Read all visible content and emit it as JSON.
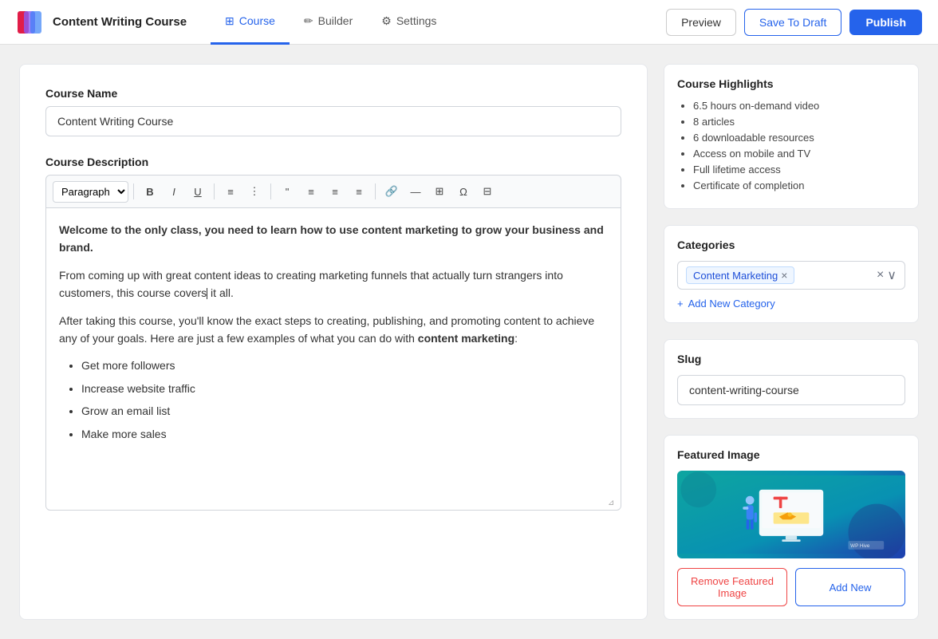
{
  "app": {
    "logo_alt": "App Logo",
    "title": "Content Writing Course"
  },
  "nav": {
    "items": [
      {
        "id": "course",
        "label": "Course",
        "icon": "☰",
        "active": true
      },
      {
        "id": "builder",
        "label": "Builder",
        "icon": "✏️",
        "active": false
      },
      {
        "id": "settings",
        "label": "Settings",
        "icon": "⚙️",
        "active": false
      }
    ]
  },
  "toolbar": {
    "preview_label": "Preview",
    "save_label": "Save To Draft",
    "publish_label": "Publish"
  },
  "form": {
    "course_name_label": "Course Name",
    "course_name_value": "Content Writing Course",
    "course_description_label": "Course Description",
    "editor_paragraph_select": "Paragraph",
    "editor_content_bold": "Welcome to the only class, you need to learn how to use content marketing to grow your business and brand.",
    "editor_content_p1": "From coming up with great content ideas to creating marketing funnels that actually turn strangers into customers, this course covers",
    "editor_content_p1_after": " it all.",
    "editor_content_p2_before": "After taking this course, you'll know the exact steps to creating, publishing, and promoting content to achieve any of your goals. Here are just a few examples of what you can do with ",
    "editor_content_p2_bold": "content marketing",
    "editor_content_p2_after": ":",
    "editor_list_items": [
      "Get more followers",
      "Increase website traffic",
      "Grow an email list",
      "Make more sales"
    ]
  },
  "sidebar": {
    "highlights": {
      "title": "Course Highlights",
      "items": [
        "6.5 hours on-demand video",
        "8 articles",
        "6 downloadable resources",
        "Access on mobile and TV",
        "Full lifetime access",
        "Certificate of completion"
      ]
    },
    "categories": {
      "title": "Categories",
      "selected": [
        "Content Marketing"
      ],
      "add_label": "Add New Category",
      "clear_icon": "×",
      "chevron_icon": "∨"
    },
    "slug": {
      "title": "Slug",
      "value": "content-writing-course"
    },
    "featured_image": {
      "title": "Featured Image",
      "remove_label": "Remove Featured Image",
      "add_label": "Add New"
    }
  }
}
